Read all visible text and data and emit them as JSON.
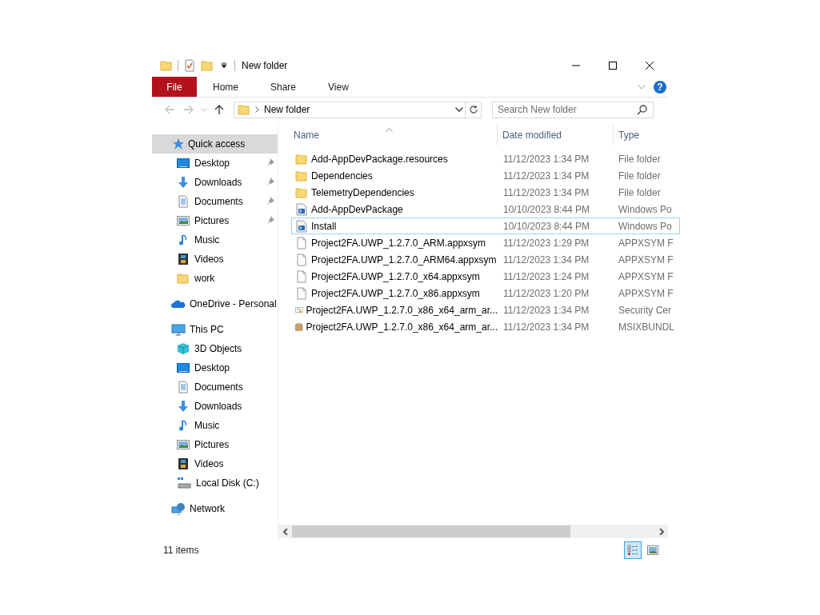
{
  "window": {
    "title": "New folder"
  },
  "quick_access_toolbar": {
    "has_dropdown": true
  },
  "ribbon": {
    "tabs": [
      {
        "label": "File",
        "kind": "file",
        "selected": false
      },
      {
        "label": "Home",
        "kind": "tab",
        "selected": false
      },
      {
        "label": "Share",
        "kind": "tab",
        "selected": false
      },
      {
        "label": "View",
        "kind": "tab",
        "selected": false
      }
    ],
    "help": "?"
  },
  "navigation": {
    "back_disabled": true,
    "forward_disabled": true,
    "up_disabled": false,
    "address": [
      "New folder"
    ],
    "search": {
      "placeholder": "Search New folder"
    }
  },
  "sidebar": {
    "items": [
      {
        "label": "Quick access",
        "kind": "star",
        "selected": true,
        "children": [
          {
            "label": "Desktop",
            "kind": "desktop",
            "pinned": true,
            "selected": false
          },
          {
            "label": "Downloads",
            "kind": "downloads",
            "pinned": true,
            "selected": false
          },
          {
            "label": "Documents",
            "kind": "documents",
            "pinned": true,
            "selected": false
          },
          {
            "label": "Pictures",
            "kind": "pictures",
            "pinned": true,
            "selected": false
          },
          {
            "label": "Music",
            "kind": "music",
            "pinned": false,
            "selected": false
          },
          {
            "label": "Videos",
            "kind": "videos",
            "pinned": false,
            "selected": false
          },
          {
            "label": "work",
            "kind": "folder",
            "pinned": false,
            "selected": false
          }
        ]
      },
      {
        "label": "OneDrive - Personal",
        "kind": "cloud",
        "selected": false
      },
      {
        "label": "This PC",
        "kind": "pc",
        "selected": false,
        "children": [
          {
            "label": "3D Objects",
            "kind": "cube",
            "selected": false
          },
          {
            "label": "Desktop",
            "kind": "desktop",
            "selected": false
          },
          {
            "label": "Documents",
            "kind": "documents",
            "selected": false
          },
          {
            "label": "Downloads",
            "kind": "downloads",
            "selected": false
          },
          {
            "label": "Music",
            "kind": "music",
            "selected": false
          },
          {
            "label": "Pictures",
            "kind": "pictures",
            "selected": false
          },
          {
            "label": "Videos",
            "kind": "videos",
            "selected": false
          },
          {
            "label": "Local Disk (C:)",
            "kind": "disk",
            "selected": false
          }
        ]
      },
      {
        "label": "Network",
        "kind": "network",
        "selected": false
      }
    ]
  },
  "table": {
    "columns": [
      {
        "label": "Name",
        "sorted": true
      },
      {
        "label": "Date modified",
        "sorted": false
      },
      {
        "label": "Type",
        "sorted": false
      }
    ],
    "rows": [
      {
        "name": "Add-AppDevPackage.resources",
        "date": "11/12/2023 1:34 PM",
        "type": "File folder",
        "kind": "folder",
        "focused": false
      },
      {
        "name": "Dependencies",
        "date": "11/12/2023 1:34 PM",
        "type": "File folder",
        "kind": "folder",
        "focused": false
      },
      {
        "name": "TelemetryDependencies",
        "date": "11/12/2023 1:34 PM",
        "type": "File folder",
        "kind": "folder",
        "focused": false
      },
      {
        "name": "Add-AppDevPackage",
        "date": "10/10/2023 8:44 PM",
        "type": "Windows Po",
        "kind": "script",
        "focused": false
      },
      {
        "name": "Install",
        "date": "10/10/2023 8:44 PM",
        "type": "Windows Po",
        "kind": "script",
        "focused": true
      },
      {
        "name": "Project2FA.UWP_1.2.7.0_ARM.appxsym",
        "date": "11/12/2023 1:29 PM",
        "type": "APPXSYM F",
        "kind": "blank",
        "focused": false
      },
      {
        "name": "Project2FA.UWP_1.2.7.0_ARM64.appxsym",
        "date": "11/12/2023 1:34 PM",
        "type": "APPXSYM F",
        "kind": "blank",
        "focused": false
      },
      {
        "name": "Project2FA.UWP_1.2.7.0_x64.appxsym",
        "date": "11/12/2023 1:24 PM",
        "type": "APPXSYM F",
        "kind": "blank",
        "focused": false
      },
      {
        "name": "Project2FA.UWP_1.2.7.0_x86.appxsym",
        "date": "11/12/2023 1:20 PM",
        "type": "APPXSYM F",
        "kind": "blank",
        "focused": false
      },
      {
        "name": "Project2FA.UWP_1.2.7.0_x86_x64_arm_ar...",
        "date": "11/12/2023 1:34 PM",
        "type": "Security Cer",
        "kind": "certificate",
        "focused": false
      },
      {
        "name": "Project2FA.UWP_1.2.7.0_x86_x64_arm_ar...",
        "date": "11/12/2023 1:34 PM",
        "type": "MSIXBUNDL",
        "kind": "package",
        "focused": false
      }
    ]
  },
  "status_bar": {
    "text": "11 items",
    "views": [
      {
        "kind": "details",
        "selected": true
      },
      {
        "kind": "large",
        "selected": false
      }
    ]
  }
}
